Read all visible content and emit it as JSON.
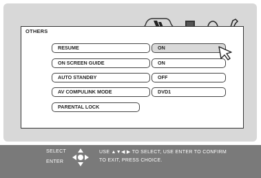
{
  "menu": {
    "title": "OTHERS",
    "tabs": [
      "pen-icon",
      "book-icon",
      "disc-icon",
      "wrench-icon"
    ],
    "items": [
      {
        "label": "RESUME",
        "value": "ON",
        "selected": true
      },
      {
        "label": "ON SCREEN GUIDE",
        "value": "ON",
        "selected": false
      },
      {
        "label": "AUTO STANDBY",
        "value": "OFF",
        "selected": false
      },
      {
        "label": "AV COMPULINK MODE",
        "value": "DVD1",
        "selected": false
      },
      {
        "label": "PARENTAL LOCK",
        "value": null,
        "selected": false
      }
    ]
  },
  "footer": {
    "key1": "SELECT",
    "key2": "ENTER",
    "line1": "USE ▲▼◀ ▶ TO SELECT, USE ENTER TO CONFIRM",
    "line2": "TO EXIT, PRESS CHOICE."
  }
}
